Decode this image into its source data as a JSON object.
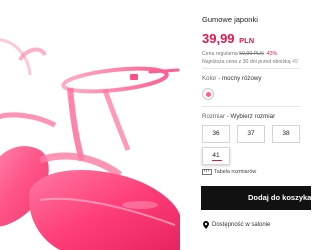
{
  "product": {
    "title": "Gumowe japonki",
    "price": "39,99",
    "currency": "PLN",
    "regular_price_label": "Cena regularna",
    "regular_price": "59,99 PLN",
    "discount": "-43%",
    "lowest_price_label": "Najniższa cena z 30 dni przed obniżką",
    "lowest_price": "49"
  },
  "color": {
    "label": "Kolor",
    "value": "mocny różowy",
    "swatch_color": "#ff5e95"
  },
  "size": {
    "label": "Rozmiar",
    "prompt": "Wybierz rozmiar",
    "options": [
      "36",
      "37",
      "38",
      "41"
    ],
    "size_table_label": "Tabela rozmiarów"
  },
  "actions": {
    "add_to_cart": "Dodaj do koszyka"
  },
  "availability": {
    "label": "Dostępność w salonie"
  },
  "colors": {
    "accent": "#e0174b",
    "button_bg": "#111111",
    "product_pink": "#ff3f7a"
  },
  "icons": [
    "ruler-icon",
    "location-pin-icon"
  ]
}
